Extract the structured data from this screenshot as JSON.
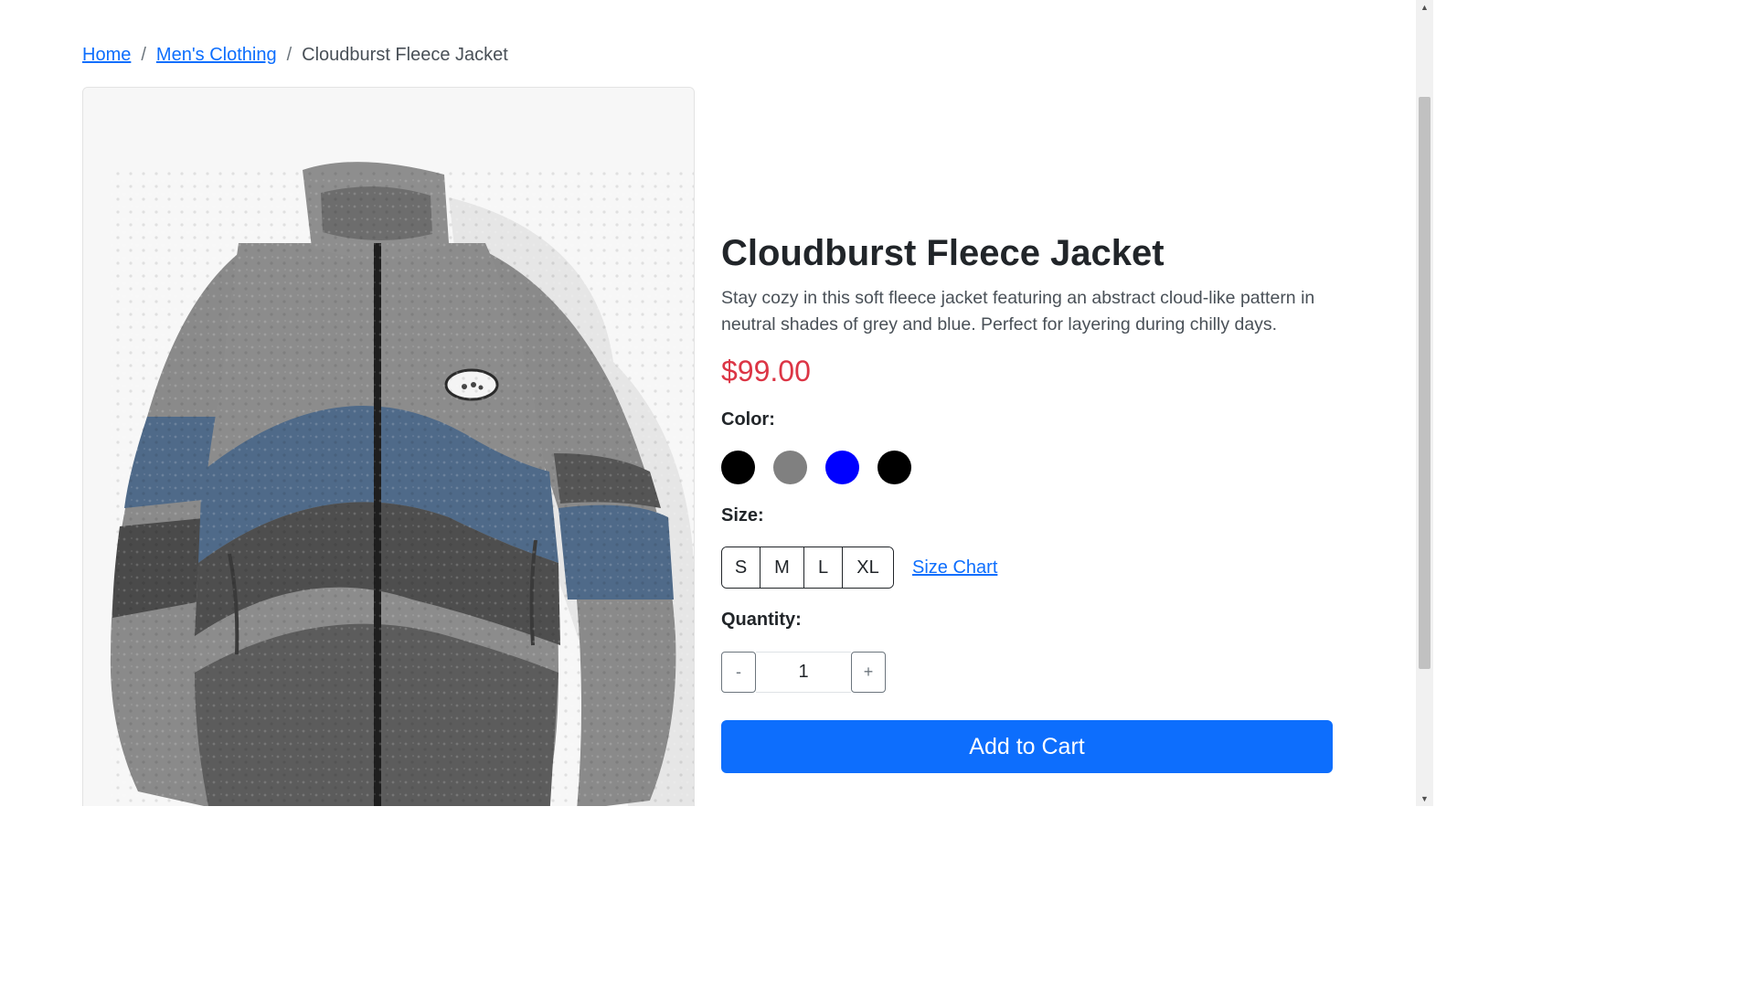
{
  "breadcrumb": {
    "home": "Home",
    "category": "Men's Clothing",
    "separator": "/",
    "current": "Cloudburst Fleece Jacket"
  },
  "product": {
    "image_alt": "Cloudburst Fleece Jacket",
    "title": "Cloudburst Fleece Jacket",
    "description": "Stay cozy in this soft fleece jacket featuring an abstract cloud-like pattern in neutral shades of grey and blue. Perfect for layering during chilly days.",
    "price": "$99.00"
  },
  "options": {
    "color_label": "Color:",
    "colors": [
      "#000000",
      "#808080",
      "#0000ff",
      "#000000"
    ],
    "size_label": "Size:",
    "sizes": [
      "S",
      "M",
      "L",
      "XL"
    ],
    "size_chart_link": "Size Chart",
    "quantity_label": "Quantity:",
    "quantity_value": "1",
    "decrement": "-",
    "increment": "+"
  },
  "cart": {
    "add_to_cart_label": "Add to Cart"
  },
  "theme": {
    "primary": "#0d6efd",
    "price_red": "#dc3545"
  }
}
